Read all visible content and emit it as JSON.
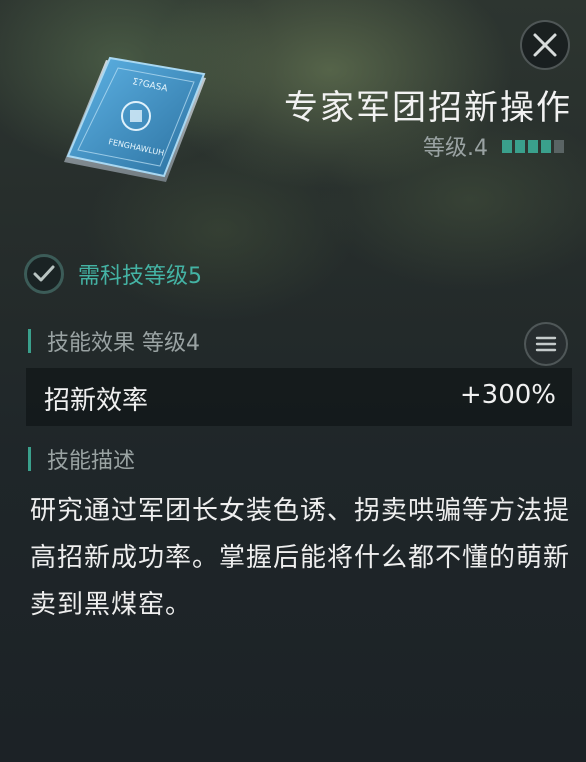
{
  "skill": {
    "title": "专家军团招新操作",
    "level_label": "等级.4",
    "level": {
      "current": 4,
      "max": 5
    },
    "card_text_top": "Σ?GASA",
    "card_text_bottom": "FENGHAWLUH"
  },
  "requirement": {
    "text": "需科技等级5",
    "met": true
  },
  "effect_section": {
    "title": "技能效果 等级4",
    "rows": [
      {
        "name": "招新效率",
        "value": "+300%"
      }
    ]
  },
  "description_section": {
    "title": "技能描述",
    "text": "研究通过军团长女装色诱、拐卖哄骗等方法提高招新成功率。掌握后能将什么都不懂的萌新卖到黑煤窑。"
  },
  "colors": {
    "accent": "#3aa08c",
    "requirement_text": "#44b3a4",
    "pip_off": "#5a6464"
  },
  "icons": [
    "close-icon",
    "skill-card-icon",
    "checkmark-icon",
    "menu-icon"
  ]
}
